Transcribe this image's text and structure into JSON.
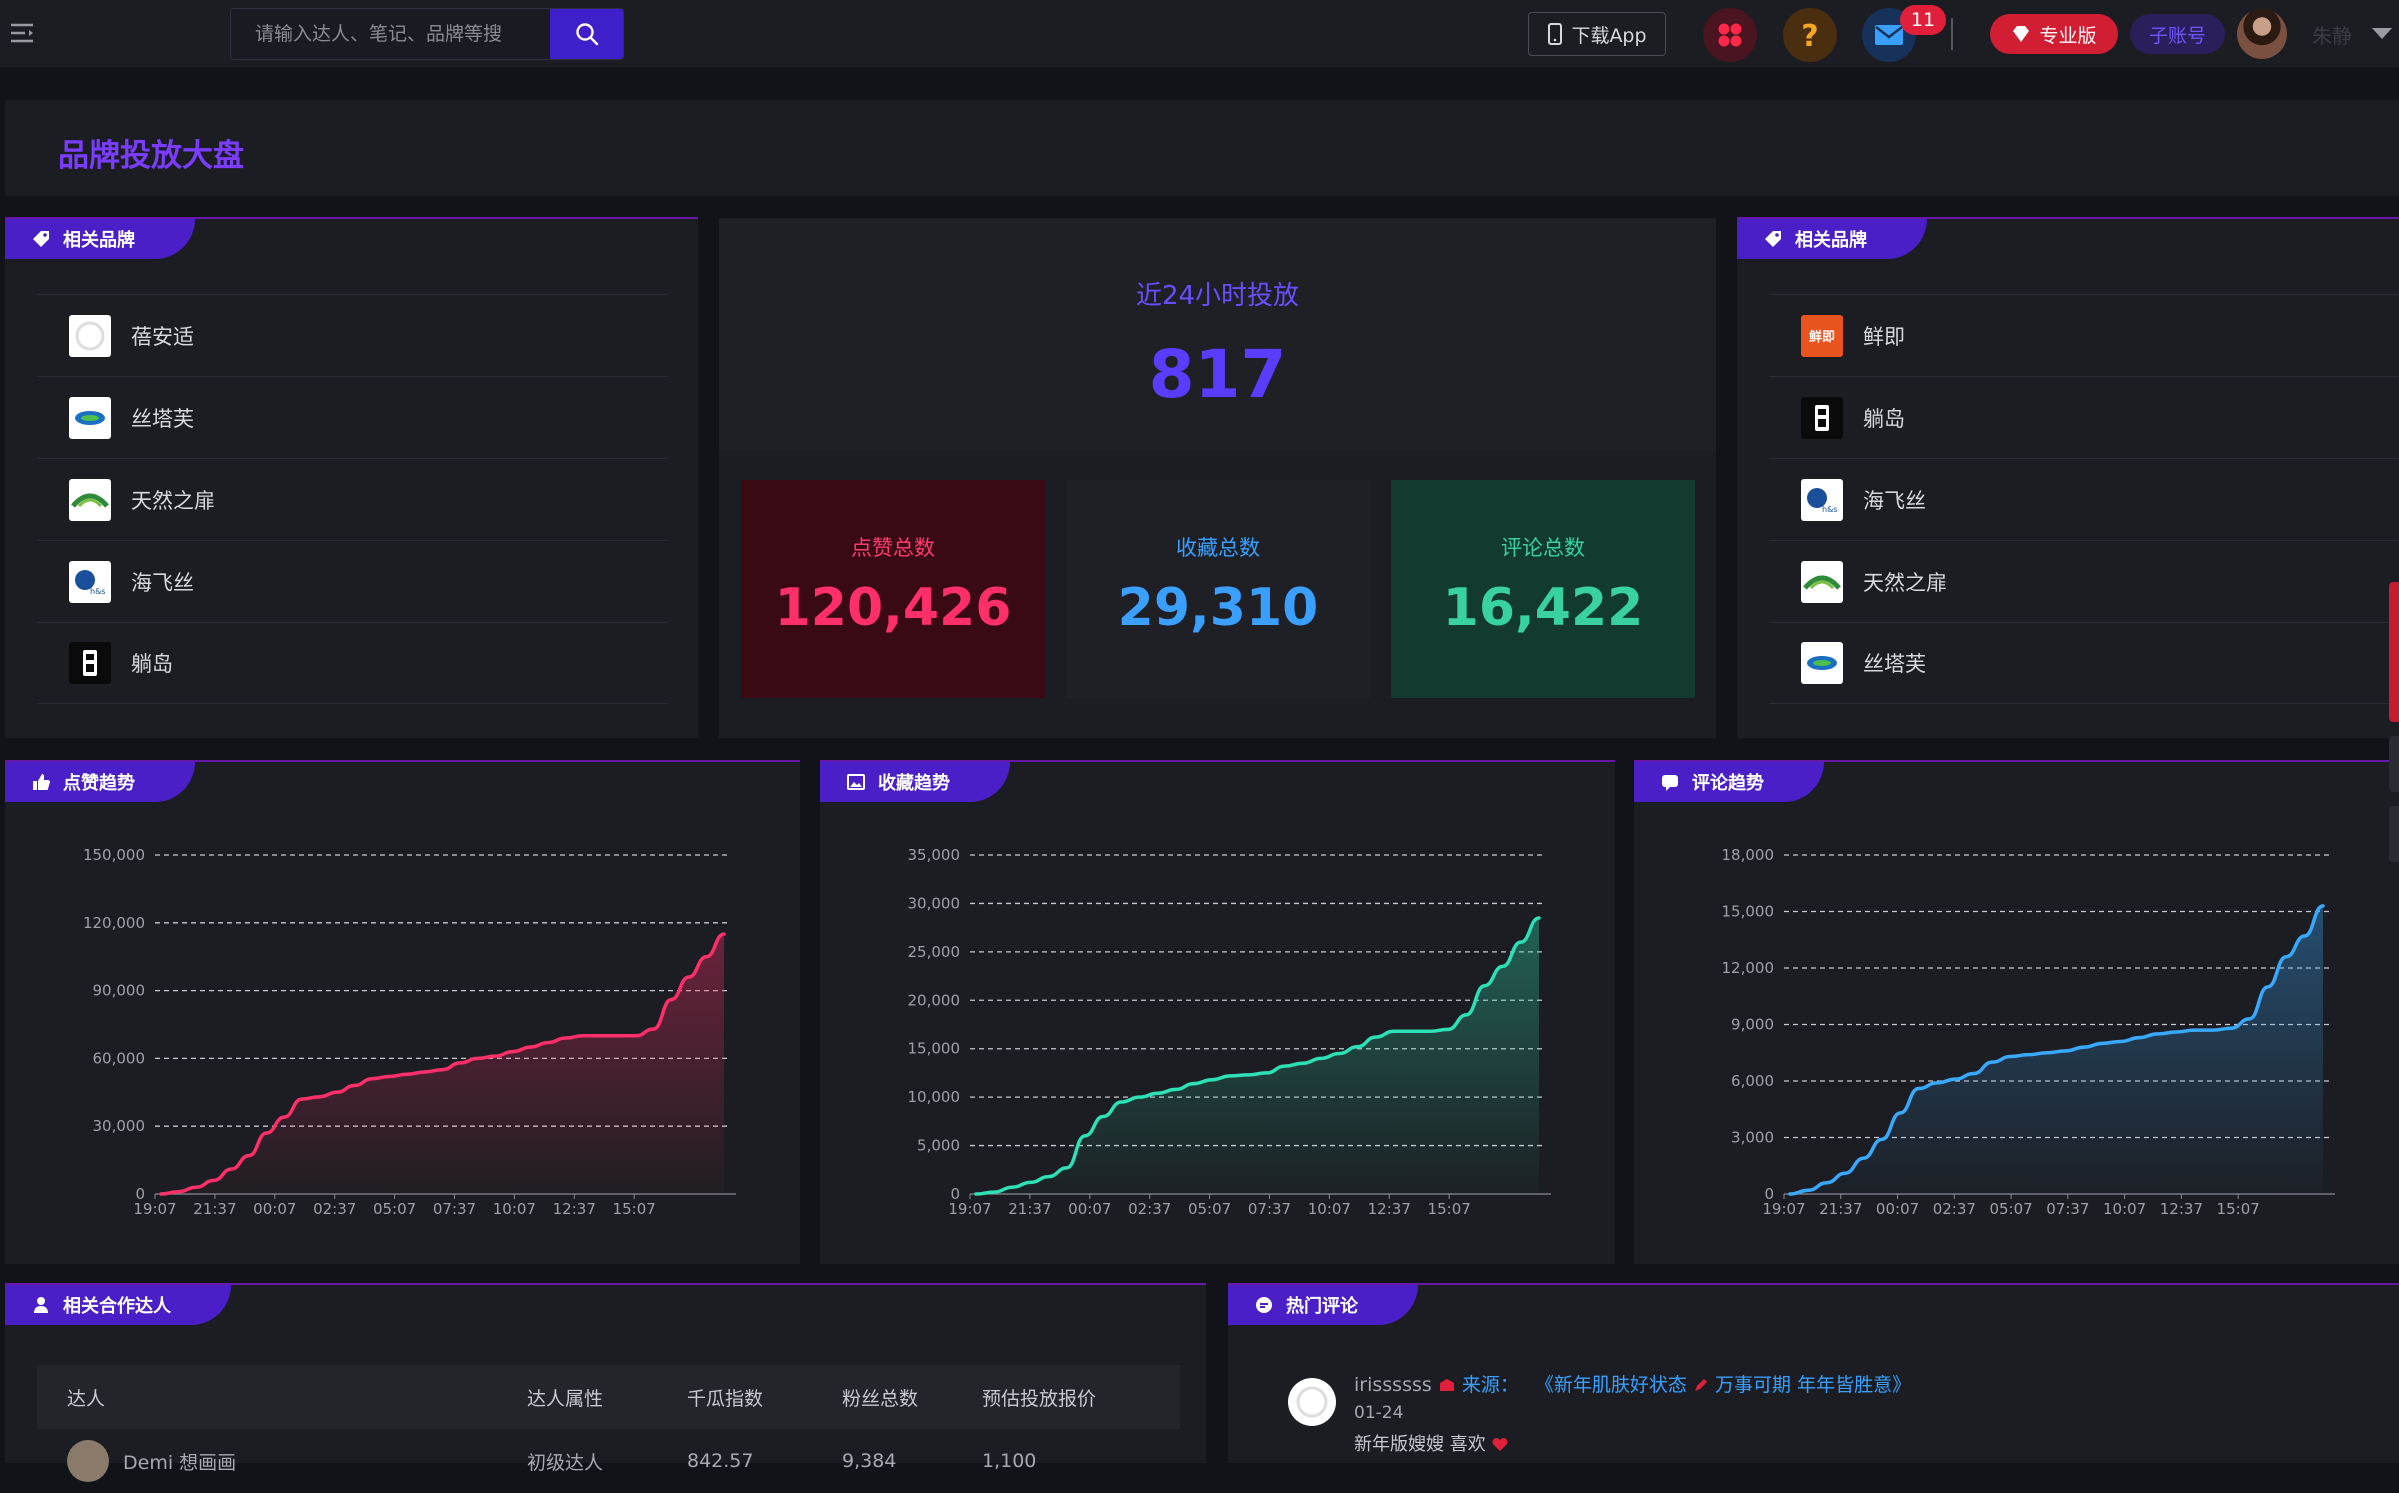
{
  "header": {
    "search_placeholder": "请输入达人、笔记、品牌等搜",
    "download_app_label": "下载App",
    "mail_badge_count": "11",
    "pro_label": "专业版",
    "sub_account_label": "子账号",
    "username": "朱静"
  },
  "page_title": "品牌投放大盘",
  "left_brands": {
    "title": "相关品牌",
    "items": [
      {
        "name": "蓓安适",
        "logo": "circle-logo"
      },
      {
        "name": "丝塔芙",
        "logo": "cetaphil-logo"
      },
      {
        "name": "天然之扉",
        "logo": "green-leaf-logo"
      },
      {
        "name": "海飞丝",
        "logo": "head-shoulders-logo"
      },
      {
        "name": "躺岛",
        "logo": "black-badge-logo"
      }
    ]
  },
  "right_brands": {
    "title": "相关品牌",
    "items": [
      {
        "name": "鲜即",
        "logo": "orange-badge-logo",
        "logo_text": "鲜即"
      },
      {
        "name": "躺岛",
        "logo": "black-badge-logo"
      },
      {
        "name": "海飞丝",
        "logo": "head-shoulders-logo"
      },
      {
        "name": "天然之扉",
        "logo": "green-leaf-logo"
      },
      {
        "name": "丝塔芙",
        "logo": "cetaphil-logo"
      }
    ]
  },
  "summary": {
    "last24_label": "近24小时投放",
    "last24_value": "817",
    "likes_label": "点赞总数",
    "likes_value": "120,426",
    "favorites_label": "收藏总数",
    "favorites_value": "29,310",
    "comments_label": "评论总数",
    "comments_value": "16,422"
  },
  "colors": {
    "accent": "#4b1fc7",
    "likes": "#ff2f6a",
    "favorites": "#3aa0ff",
    "comments": "#3ad1a0",
    "likes_chart": "#ff2f6a",
    "favorites_chart": "#2de0b5",
    "comments_chart": "#39a9ff"
  },
  "chart_data": [
    {
      "type": "area",
      "title": "点赞趋势",
      "x_ticks": [
        "19:07",
        "21:37",
        "00:07",
        "02:37",
        "05:07",
        "07:37",
        "10:07",
        "12:37",
        "15:07"
      ],
      "y_ticks": [
        "150,000",
        "120,000",
        "90,000",
        "60,000",
        "30,000",
        "0"
      ],
      "ylim": [
        0,
        150000
      ],
      "series": [
        {
          "values": [
            0,
            1000,
            3000,
            6000,
            11000,
            17000,
            27000,
            34000,
            42000,
            43000,
            45000,
            48000,
            51000,
            52000,
            53000,
            54000,
            55000,
            58000,
            60000,
            61000,
            63000,
            65000,
            67000,
            69000,
            70000,
            70000,
            70000,
            70000,
            73000,
            86000,
            96000,
            105000,
            115000
          ]
        }
      ]
    },
    {
      "type": "area",
      "title": "收藏趋势",
      "x_ticks": [
        "19:07",
        "21:37",
        "00:07",
        "02:37",
        "05:07",
        "07:37",
        "10:07",
        "12:37",
        "15:07"
      ],
      "y_ticks": [
        "35,000",
        "30,000",
        "25,000",
        "20,000",
        "15,000",
        "10,000",
        "5,000",
        "0"
      ],
      "ylim": [
        0,
        35000
      ],
      "series": [
        {
          "values": [
            0,
            200,
            700,
            1200,
            1800,
            2700,
            6000,
            8000,
            9500,
            10000,
            10400,
            10800,
            11400,
            11800,
            12200,
            12300,
            12500,
            13200,
            13500,
            14000,
            14500,
            15200,
            16200,
            16800,
            16800,
            16800,
            17000,
            18500,
            21500,
            23500,
            26000,
            28500
          ]
        }
      ]
    },
    {
      "type": "area",
      "title": "评论趋势",
      "x_ticks": [
        "19:07",
        "21:37",
        "00:07",
        "02:37",
        "05:07",
        "07:37",
        "10:07",
        "12:37",
        "15:07"
      ],
      "y_ticks": [
        "18,000",
        "15,000",
        "12,000",
        "9,000",
        "6,000",
        "3,000",
        "0"
      ],
      "ylim": [
        0,
        18000
      ],
      "series": [
        {
          "values": [
            0,
            200,
            600,
            1100,
            1900,
            2900,
            4300,
            5600,
            5900,
            6100,
            6400,
            7000,
            7300,
            7400,
            7500,
            7600,
            7800,
            8000,
            8100,
            8300,
            8500,
            8600,
            8700,
            8700,
            8800,
            9300,
            11000,
            12600,
            13700,
            15300
          ]
        }
      ]
    }
  ],
  "cooperators": {
    "title": "相关合作达人",
    "columns": [
      "达人",
      "达人属性",
      "千瓜指数",
      "粉丝总数",
      "预估投放报价"
    ],
    "rows": [
      [
        "Demi 想画画",
        "初级达人",
        "842.57",
        "9,384",
        "1,100"
      ]
    ]
  },
  "hot_comments": {
    "title": "热门评论",
    "items": [
      {
        "user": "irissssss",
        "source_prefix": "来源：",
        "source_title": "《新年肌肤好状态",
        "source_title_2": "万事可期 年年皆胜意》",
        "date": "01-24",
        "text": "新年版嫂嫂 喜欢"
      }
    ]
  }
}
